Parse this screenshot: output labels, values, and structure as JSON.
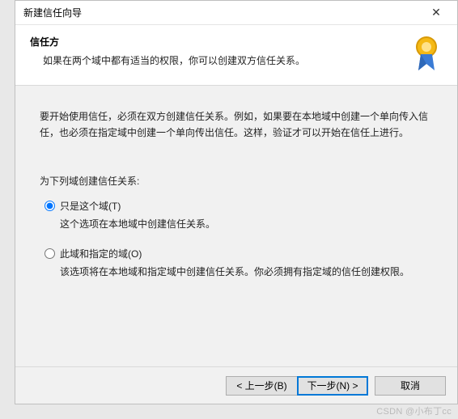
{
  "window": {
    "title": "新建信任向导",
    "close_glyph": "✕"
  },
  "header": {
    "heading": "信任方",
    "subtitle": "如果在两个域中都有适当的权限，你可以创建双方信任关系。"
  },
  "content": {
    "instruction": "要开始使用信任，必须在双方创建信任关系。例如，如果要在本地域中创建一个单向传入信任，也必须在指定域中创建一个单向传出信任。这样，验证才可以开始在信任上进行。",
    "section_label": "为下列域创建信任关系:",
    "options": [
      {
        "value": "this",
        "label": "只是这个域(T)",
        "desc": "这个选项在本地域中创建信任关系。",
        "checked": true
      },
      {
        "value": "both",
        "label": "此域和指定的域(O)",
        "desc": "该选项将在本地域和指定域中创建信任关系。你必须拥有指定域的信任创建权限。",
        "checked": false
      }
    ]
  },
  "footer": {
    "back": "< 上一步(B)",
    "next": "下一步(N) >",
    "cancel": "取消"
  },
  "watermark": "CSDN @小布丁cc"
}
